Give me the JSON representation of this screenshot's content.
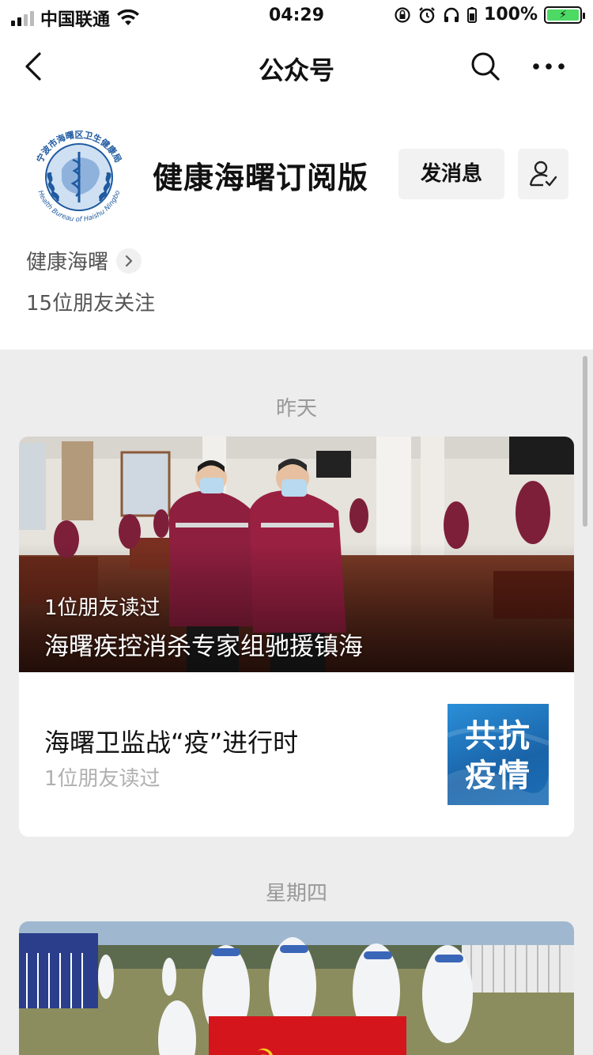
{
  "status_bar": {
    "carrier": "中国联通",
    "time": "04:29",
    "battery_percent": "100%"
  },
  "nav": {
    "title": "公众号",
    "back_icon": "chevron-left-icon",
    "search_icon": "search-icon",
    "more_icon": "more-icon"
  },
  "profile": {
    "account_name": "健康海曙订阅版",
    "send_message_label": "发消息",
    "org_name": "健康海曙",
    "friends_following": "15位朋友关注",
    "logo_text_top": "宁波市海曙区卫生健康局",
    "logo_text_bottom": "Health Bureau of Haishu Ningbo"
  },
  "feed": {
    "groups": [
      {
        "date_label": "昨天",
        "lead": {
          "read_by": "1位朋友读过",
          "title": "海曙疾控消杀专家组驰援镇海"
        },
        "items": [
          {
            "title": "海曙卫监战“疫”进行时",
            "read_by": "1位朋友读过",
            "thumb_line1": "共抗",
            "thumb_line2": "疫情"
          }
        ]
      },
      {
        "date_label": "星期四"
      }
    ]
  },
  "colors": {
    "background": "#ededed",
    "card": "#ffffff",
    "thumb_blue": "#1f78c8",
    "battery_green": "#4cd964"
  }
}
